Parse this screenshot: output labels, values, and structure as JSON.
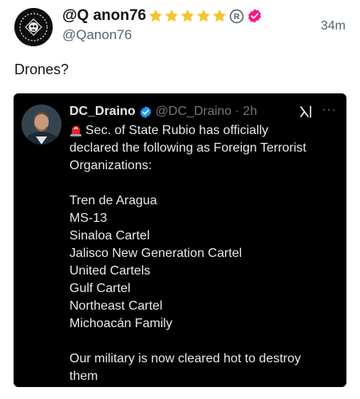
{
  "post": {
    "display_name": "@Q anon76",
    "handle": "@Qanon76",
    "time": "34m",
    "text": "Drones?",
    "badges": {
      "stars": 5,
      "star_color": "#f5c32c",
      "registered_mark": "®",
      "verified_color": "#f91880"
    },
    "avatar_icon": "skull-logo-icon"
  },
  "quote": {
    "display_name": "DC_Draino",
    "handle": "@DC_Draino · 2h",
    "verified_color": "#1d9bf0",
    "more_label": "···",
    "grok_icon": "grok-icon",
    "lines": [
      "Sec. of State Rubio has officially",
      "declared the following as Foreign Terrorist",
      "Organizations:",
      "",
      "Tren de Aragua",
      "MS-13",
      "Sinaloa Cartel",
      "Jalisco New Generation Cartel",
      "United Cartels",
      "Gulf Cartel",
      "Northeast Cartel",
      "Michoacán Family",
      "",
      "Our military is now cleared hot to destroy",
      "them"
    ],
    "leading_emoji": "rotating-light-emoji"
  }
}
